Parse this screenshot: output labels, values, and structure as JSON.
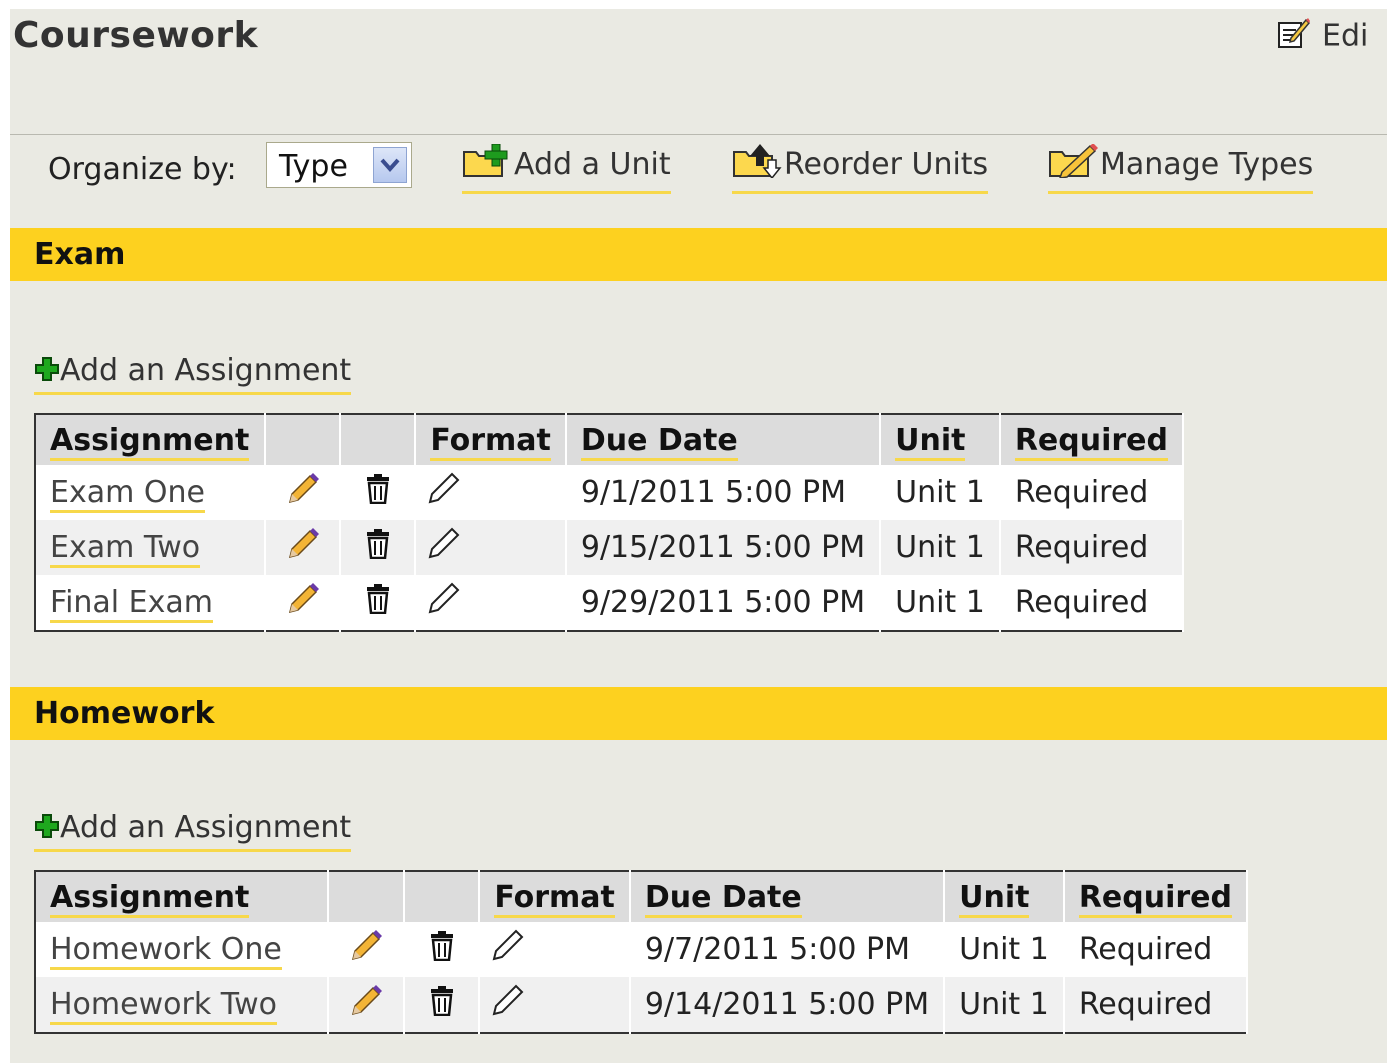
{
  "header": {
    "title": "Coursework",
    "edit_label": "Edi"
  },
  "toolbar": {
    "organize_label": "Organize by:",
    "organize_value": "Type",
    "add_unit": "Add a Unit",
    "reorder_units": "Reorder Units",
    "manage_types": "Manage Types"
  },
  "columns": {
    "assignment": "Assignment",
    "format": "Format",
    "due_date": "Due Date",
    "unit": "Unit",
    "required": "Required"
  },
  "sections": [
    {
      "name": "Exam",
      "add_label": "Add an Assignment",
      "rows": [
        {
          "name": "Exam One",
          "due": "9/1/2011 5:00 PM",
          "unit": "Unit 1",
          "required": "Required"
        },
        {
          "name": "Exam Two",
          "due": "9/15/2011 5:00 PM",
          "unit": "Unit 1",
          "required": "Required"
        },
        {
          "name": "Final Exam",
          "due": "9/29/2011 5:00 PM",
          "unit": "Unit 1",
          "required": "Required"
        }
      ]
    },
    {
      "name": "Homework",
      "add_label": "Add an Assignment",
      "rows": [
        {
          "name": "Homework One",
          "due": "9/7/2011 5:00 PM",
          "unit": "Unit 1",
          "required": "Required"
        },
        {
          "name": "Homework Two",
          "due": "9/14/2011 5:00 PM",
          "unit": "Unit 1",
          "required": "Required"
        }
      ]
    }
  ],
  "icons": {
    "edit_page": "edit-page-icon",
    "add_unit": "folder-add-icon",
    "reorder_units": "folder-reorder-icon",
    "manage_types": "manage-types-icon",
    "add_assignment": "green-plus-icon",
    "row_edit": "pencil-icon",
    "row_delete": "trash-icon",
    "row_format": "format-pencil-icon"
  },
  "colors": {
    "section_bar": "#fdd11f",
    "link_underline": "#f7d84a",
    "page_background": "#eaeae3"
  }
}
